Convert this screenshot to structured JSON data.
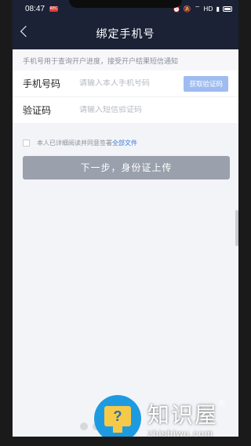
{
  "status": {
    "time": "08:47",
    "rec": "REC",
    "signal": "HD"
  },
  "nav": {
    "title": "绑定手机号"
  },
  "notice": "手机号用于查询开户进度，接受开户结果短信通知",
  "form": {
    "phone_label": "手机号码",
    "phone_placeholder": "请输入本人手机号码",
    "code_button": "获取验证码",
    "code_label": "验证码",
    "code_placeholder": "请输入短信验证码"
  },
  "agreement": {
    "prefix": "本人已详细阅读并同意签署",
    "link": "全部文件"
  },
  "next_button": "下一步，身份证上传",
  "watermark": {
    "icon_char": "?",
    "cn": "知识屋",
    "url": "zhishiwu.com",
    "reg": "®"
  },
  "colors": {
    "header": "#1b2236",
    "accent": "#3a7bdc",
    "code_button": "#9fbcf0",
    "next_button": "#9aa0ac"
  }
}
